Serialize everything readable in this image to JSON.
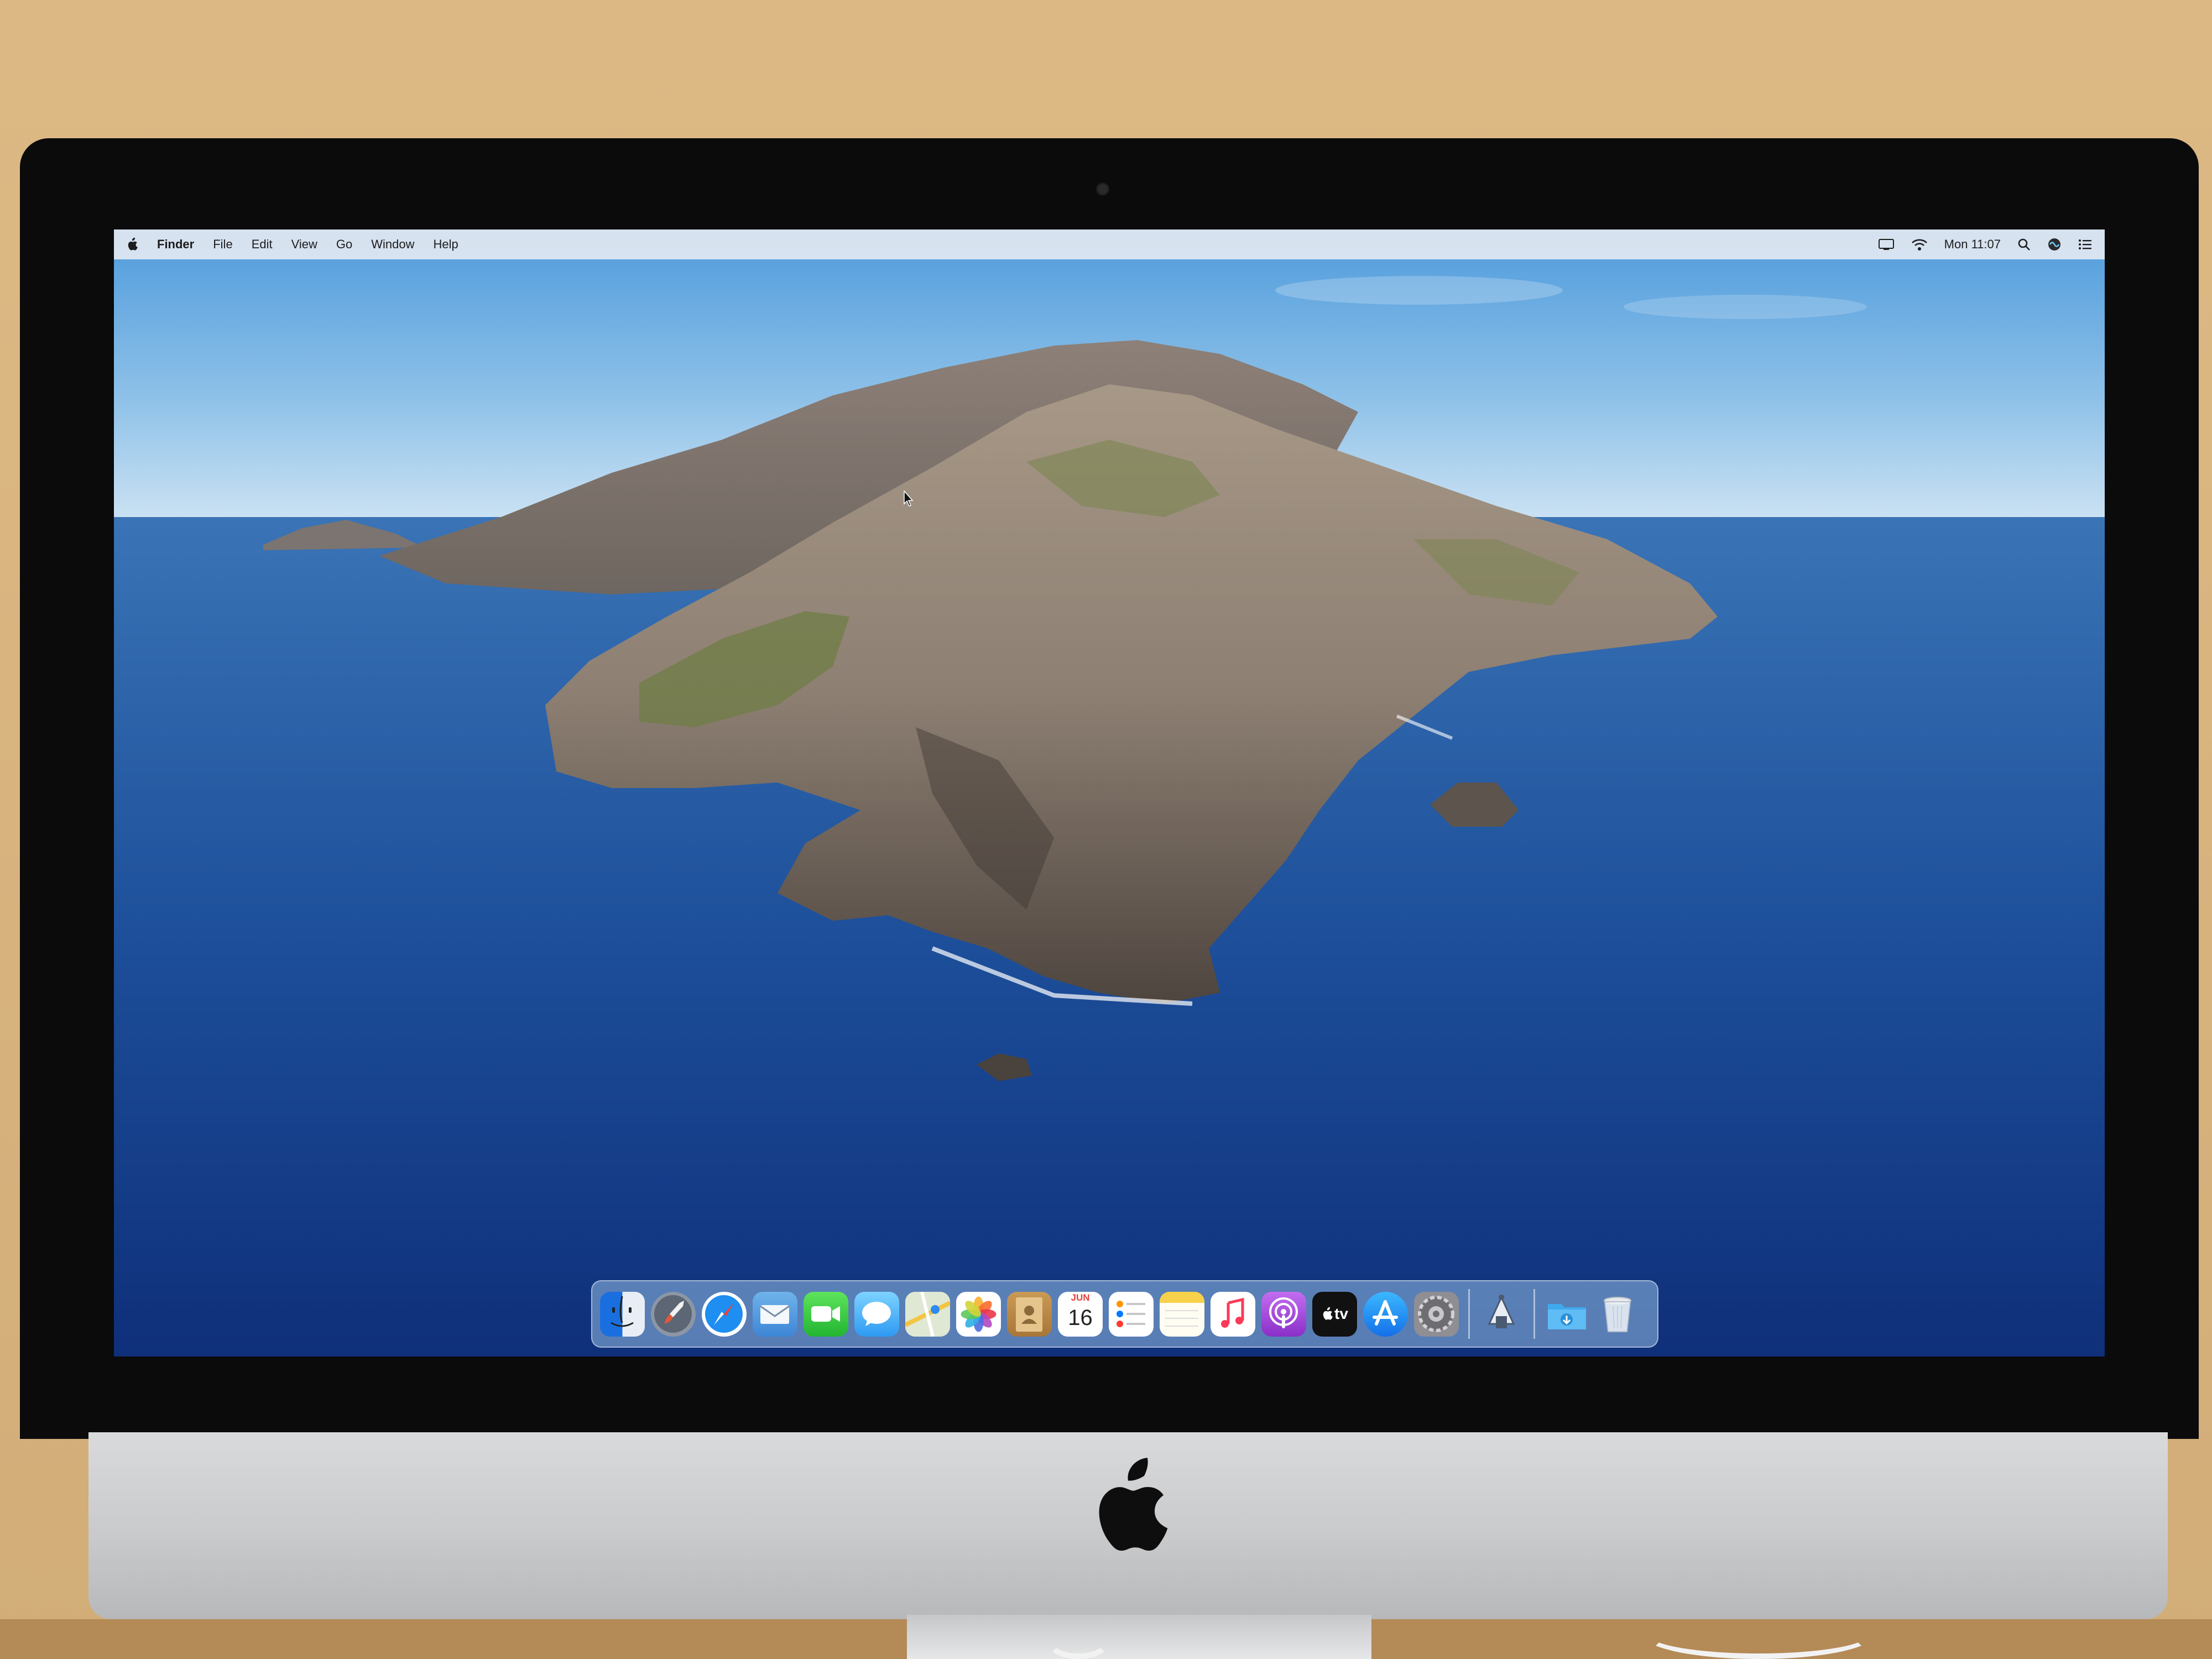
{
  "menu_bar": {
    "app_name": "Finder",
    "menus": [
      "File",
      "Edit",
      "View",
      "Go",
      "Window",
      "Help"
    ],
    "clock": "Mon 11:07",
    "status_icons": [
      "display-icon",
      "wifi-icon",
      "spotlight-icon",
      "siri-icon",
      "notification-center-icon"
    ]
  },
  "dock": {
    "apps": [
      {
        "name": "finder-icon"
      },
      {
        "name": "launchpad-icon"
      },
      {
        "name": "safari-icon"
      },
      {
        "name": "mail-icon"
      },
      {
        "name": "facetime-icon"
      },
      {
        "name": "messages-icon"
      },
      {
        "name": "maps-icon"
      },
      {
        "name": "photos-icon"
      },
      {
        "name": "contacts-icon"
      },
      {
        "name": "calendar-icon",
        "month": "JUN",
        "day": "16"
      },
      {
        "name": "reminders-icon"
      },
      {
        "name": "notes-icon"
      },
      {
        "name": "music-icon"
      },
      {
        "name": "podcasts-icon"
      },
      {
        "name": "apple-tv-icon",
        "label": "tv"
      },
      {
        "name": "app-store-icon"
      },
      {
        "name": "system-preferences-icon"
      },
      {
        "name": "app-icon"
      },
      {
        "name": "downloads-folder-icon"
      },
      {
        "name": "trash-icon"
      }
    ]
  },
  "colors": {
    "sky_top": "#4f9bdc",
    "sky_horizon": "#cfe4f4",
    "ocean_top": "#3a74b6",
    "ocean_bottom": "#0f2f7a",
    "menu_bar": "#eceef2",
    "dock": "#96bee6"
  }
}
